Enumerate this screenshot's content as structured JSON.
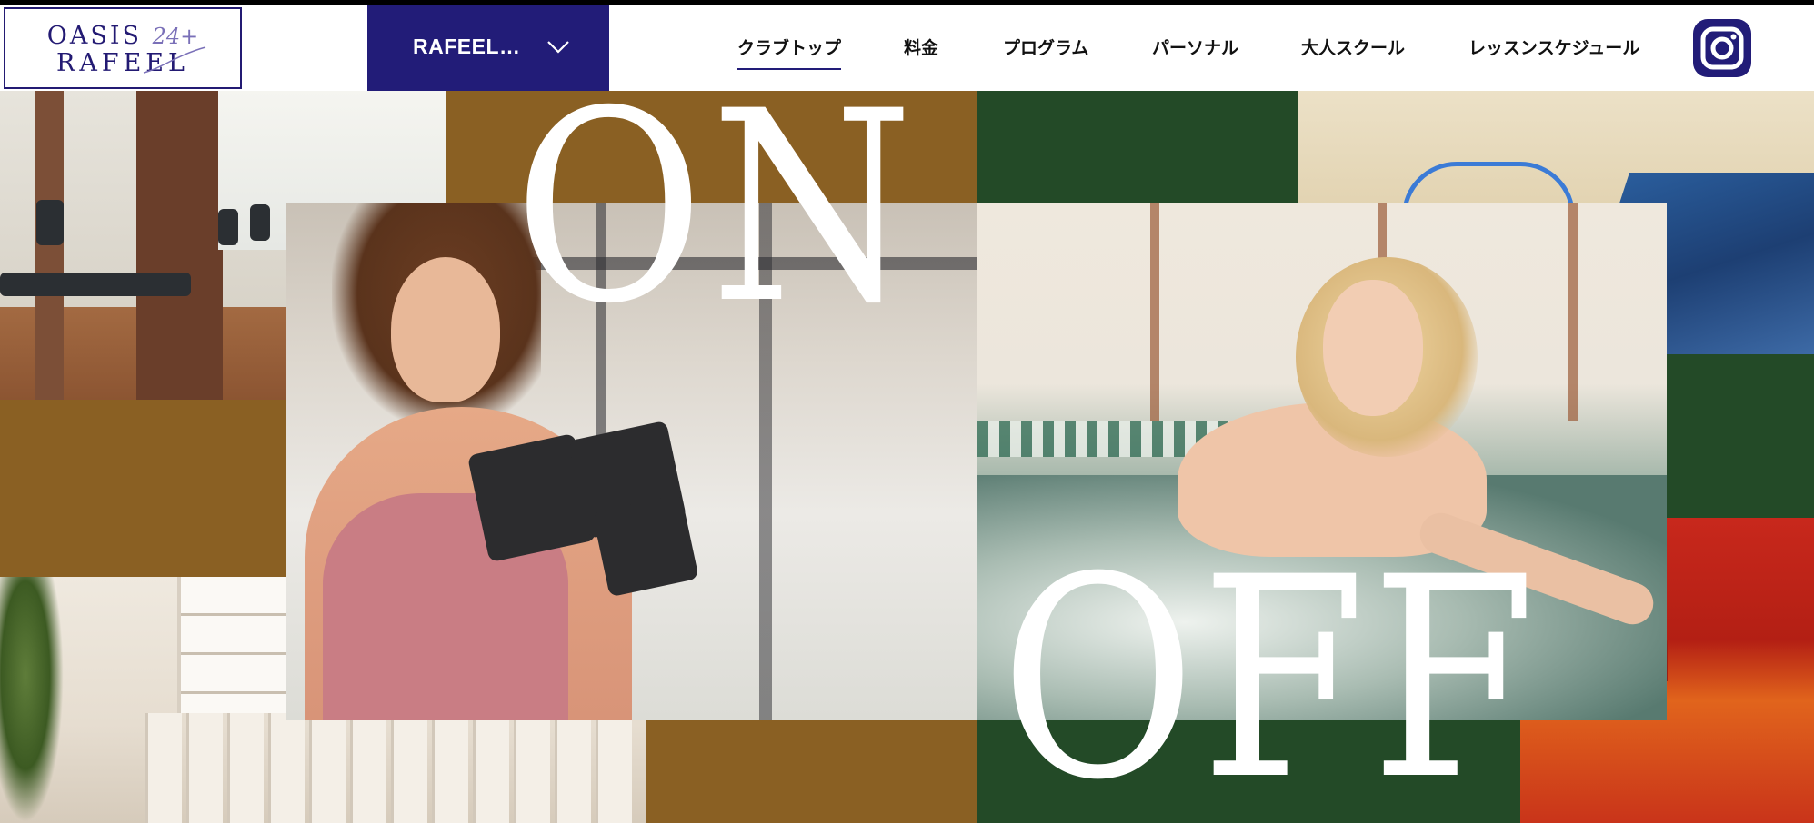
{
  "brand": {
    "logo_line1": "OASIS",
    "logo_line1_sup": "24+",
    "logo_line2": "RAFEEL",
    "color": "#221c78"
  },
  "club_selector": {
    "label": "RAFEEL…",
    "icon": "chevron-down-icon"
  },
  "nav": {
    "items": [
      {
        "label": "クラブトップ",
        "active": true
      },
      {
        "label": "料金"
      },
      {
        "label": "プログラム"
      },
      {
        "label": "パーソナル"
      },
      {
        "label": "大人スクール"
      },
      {
        "label": "レッスンスケジュール"
      }
    ],
    "instagram_icon": "instagram-icon"
  },
  "hero": {
    "word_on": "ON",
    "word_off": "OFF",
    "colors": {
      "brown": "#8a6023",
      "green": "#234a27"
    }
  }
}
